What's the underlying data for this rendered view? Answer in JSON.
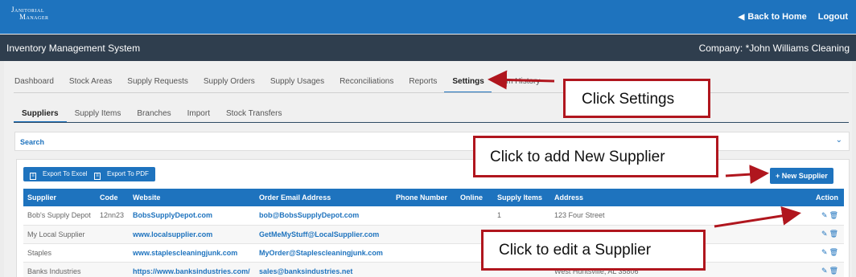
{
  "header": {
    "logo_line1": "Janitorial",
    "logo_line2": "Manager",
    "back_home": "Back to Home",
    "logout": "Logout"
  },
  "subheader": {
    "system_name": "Inventory Management System",
    "company": "Company: *John Williams Cleaning"
  },
  "main_tabs": [
    "Dashboard",
    "Stock Areas",
    "Supply Requests",
    "Supply Orders",
    "Supply Usages",
    "Reconciliations",
    "Reports",
    "Settings"
  ],
  "main_tabs_hidden_tail": "tem History",
  "active_main_tab": "Settings",
  "sub_tabs": [
    "Suppliers",
    "Supply Items",
    "Branches",
    "Import",
    "Stock Transfers"
  ],
  "active_sub_tab": "Suppliers",
  "search": {
    "label": "Search"
  },
  "buttons": {
    "export_excel": "Export To Excel",
    "export_pdf": "Export To PDF",
    "new_supplier": "+ New Supplier"
  },
  "table": {
    "headers": [
      "Supplier",
      "Code",
      "Website",
      "Order Email Address",
      "Phone Number",
      "Online",
      "Supply Items",
      "Address",
      "Action"
    ],
    "rows": [
      [
        "Bob's Supply Depot",
        "12nn23",
        "BobsSupplyDepot.com",
        "bob@BobsSupplyDepot.com",
        "",
        "",
        "1",
        "123 Four Street"
      ],
      [
        "My Local Supplier",
        "",
        "www.localsupplier.com",
        "GetMeMyStuff@LocalSupplier.com",
        "",
        "",
        "",
        ""
      ],
      [
        "Staples",
        "",
        "www.staplescleaningjunk.com",
        "MyOrder@Staplescleaningjunk.com",
        "",
        "",
        "",
        ""
      ],
      [
        "Banks Industries",
        "",
        "https://www.banksindustries.com/",
        "sales@banksindustries.net",
        "",
        "",
        "",
        "West Huntsville, AL 35806"
      ]
    ]
  },
  "callouts": {
    "settings": "Click Settings",
    "new_supplier": "Click to add New Supplier",
    "edit_supplier": "Click to edit a Supplier"
  },
  "colors": {
    "primary": "#1e73be",
    "navbar_dark": "#2f3e4e",
    "callout_border": "#b0161e"
  }
}
